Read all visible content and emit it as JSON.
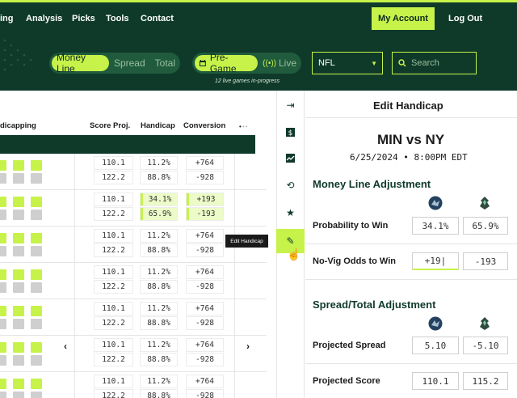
{
  "nav": {
    "items": [
      "ing",
      "Analysis",
      "Picks",
      "Tools",
      "Contact"
    ],
    "my_account": "My Account",
    "logout": "Log Out"
  },
  "filters": {
    "bet_types": [
      "Money Line",
      "Spread",
      "Total"
    ],
    "active_bet_type": "Money Line",
    "pregame": "Pre-Game",
    "live": "Live",
    "league": "NFL",
    "search_placeholder": "Search",
    "live_note": "12 live games in-progress"
  },
  "table": {
    "headers": {
      "handicapping": "dicapping",
      "score_proj": "Score Proj.",
      "handicap": "Handicap",
      "conversion": "Conversion"
    },
    "rows": [
      {
        "score": [
          "110.1",
          "122.2"
        ],
        "handicap": [
          "11.2%",
          "88.8%"
        ],
        "conversion": [
          "+764",
          "-928"
        ],
        "highlight": false
      },
      {
        "score": [
          "110.1",
          "122.2"
        ],
        "handicap": [
          "34.1%",
          "65.9%"
        ],
        "conversion": [
          "+193",
          "-193"
        ],
        "highlight": true
      },
      {
        "score": [
          "110.1",
          "122.2"
        ],
        "handicap": [
          "11.2%",
          "88.8%"
        ],
        "conversion": [
          "+764",
          "-928"
        ],
        "highlight": false
      },
      {
        "score": [
          "110.1",
          "122.2"
        ],
        "handicap": [
          "11.2%",
          "88.8%"
        ],
        "conversion": [
          "+764",
          "-928"
        ],
        "highlight": false
      },
      {
        "score": [
          "110.1",
          "122.2"
        ],
        "handicap": [
          "11.2%",
          "88.8%"
        ],
        "conversion": [
          "+764",
          "-928"
        ],
        "highlight": false
      },
      {
        "score": [
          "110.1",
          "122.2"
        ],
        "handicap": [
          "11.2%",
          "88.8%"
        ],
        "conversion": [
          "+764",
          "-928"
        ],
        "highlight": false
      },
      {
        "score": [
          "110.1",
          "122.2"
        ],
        "handicap": [
          "11.2%",
          "88.8%"
        ],
        "conversion": [
          "+764",
          "-928"
        ],
        "highlight": false
      }
    ]
  },
  "tooltip": "Edit Handicap",
  "panel": {
    "title": "Edit Handicap",
    "matchup": "MIN vs NY",
    "datetime": "6/25/2024 • 8:00PM EDT",
    "ml_section": "Money Line Adjustment",
    "prob_label": "Probability to Win",
    "prob_values": [
      "34.1%",
      "65.9%"
    ],
    "odds_label": "No-Vig Odds to Win",
    "odds_values": [
      "+19|",
      "-193"
    ],
    "st_section": "Spread/Total Adjustment",
    "spread_label": "Projected Spread",
    "spread_values": [
      "5.10",
      "-5.10"
    ],
    "score_label": "Projected Score",
    "score_values": [
      "110.1",
      "115.2"
    ]
  },
  "icons": [
    "collapse-arrow-icon",
    "dollar-icon",
    "line-chart-icon",
    "refresh-icon",
    "star-icon",
    "pencil-icon"
  ],
  "colors": {
    "accent": "#c6f24a",
    "dark": "#0f3a2a",
    "mid": "#1f5b3c"
  }
}
